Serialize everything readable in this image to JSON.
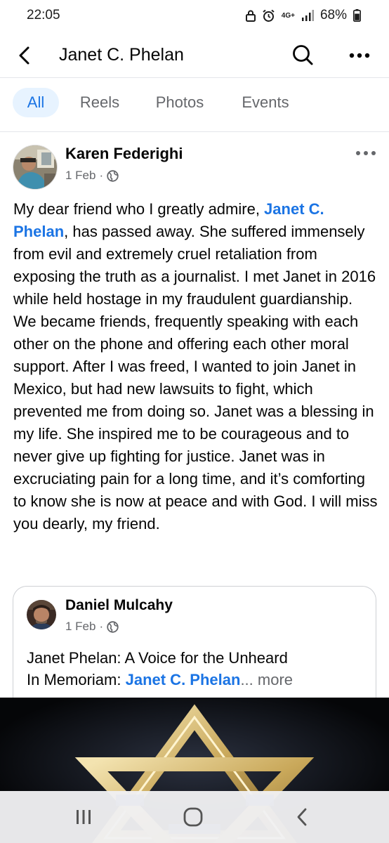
{
  "status_bar": {
    "time": "22:05",
    "network": "4G+",
    "battery": "68%",
    "icons": [
      "lock-icon",
      "alarm-icon",
      "signal-icon",
      "battery-icon"
    ]
  },
  "header": {
    "title": "Janet C. Phelan",
    "icons": [
      "back-arrow-icon",
      "search-icon",
      "more-icon"
    ]
  },
  "tabs": [
    {
      "label": "All",
      "active": true
    },
    {
      "label": "Reels",
      "active": false
    },
    {
      "label": "Photos",
      "active": false
    },
    {
      "label": "Events",
      "active": false
    }
  ],
  "post": {
    "author": "Karen Federighi",
    "date": "1 Feb",
    "separator": "·",
    "audience_icon": "globe-icon",
    "text_before_mention": "My dear friend who I greatly admire, ",
    "mention": "Janet C. Phelan",
    "text_after_mention": ", has passed away. She suffered immensely from evil and extremely cruel retaliation from exposing the truth as a journalist. I met Janet in 2016 while held hostage in my fraudulent guardianship. We became friends, frequently speaking with each other on the phone and offering each other moral support. After I was freed, I wanted to join Janet in Mexico, but had new lawsuits to fight, which  prevented me from doing so. Janet was a blessing in my life. She inspired me to be courageous and to never give up fighting for justice. Janet was in excruciating pain for a long time, and it’s comforting to know she is now at peace and with God. I will miss you dearly, my friend."
  },
  "shared_post": {
    "author": "Daniel Mulcahy",
    "date": "1 Feb",
    "separator": "·",
    "line1": "Janet Phelan: A Voice for the Unheard",
    "line2_prefix": "In Memoriam:  ",
    "line2_mention": "Janet C. Phelan",
    "ellipsis": "...",
    "see_more": " more"
  },
  "nav_bar": {
    "icons": [
      "recent-apps-icon",
      "home-icon",
      "back-icon"
    ]
  },
  "colors": {
    "accent": "#1b74e4",
    "tab_active_bg": "#e7f3ff",
    "secondary_text": "#65676b",
    "image_gold": "#c9a85a"
  }
}
